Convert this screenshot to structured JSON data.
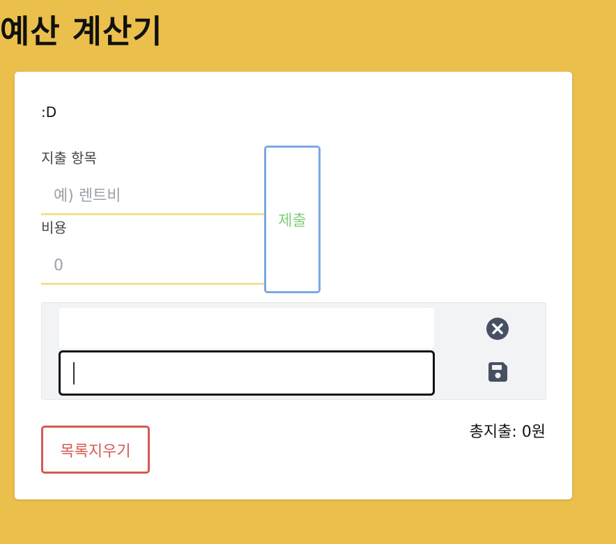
{
  "app": {
    "title": "예산 계산기"
  },
  "card": {
    "alert": ":D",
    "form": {
      "item_label": "지출 항목",
      "item_placeholder": "예) 렌트비",
      "cost_label": "비용",
      "cost_placeholder": "0",
      "submit_label": "제출"
    },
    "list": {
      "items": [
        {
          "name": "",
          "edit_value": "",
          "icons": [
            "x-circle-icon",
            "save-icon"
          ]
        }
      ]
    },
    "clear_label": "목록지우기",
    "total_text": "총지출: 0원"
  },
  "colors": {
    "background": "#ebbf4b",
    "submit_border": "#7ba7e3",
    "submit_text": "#7fcd7a",
    "clear": "#d35a50",
    "input_underline": "#f2e08f",
    "icon": "#475063"
  }
}
